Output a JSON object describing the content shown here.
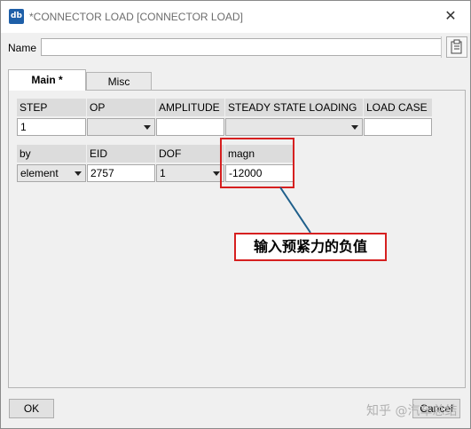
{
  "window": {
    "title": "*CONNECTOR LOAD [CONNECTOR LOAD]",
    "icon_label": "db"
  },
  "name_row": {
    "label": "Name",
    "value": ""
  },
  "tabs": [
    {
      "label": "Main *",
      "active": true
    },
    {
      "label": "Misc",
      "active": false
    }
  ],
  "row1": {
    "step": {
      "header": "STEP",
      "value": "1"
    },
    "op": {
      "header": "OP",
      "value": ""
    },
    "amplitude": {
      "header": "AMPLITUDE",
      "value": ""
    },
    "steady_state": {
      "header": "STEADY STATE LOADING",
      "value": ""
    },
    "load_case": {
      "header": "LOAD CASE",
      "value": ""
    }
  },
  "row2": {
    "by": {
      "header": "by",
      "value": "element"
    },
    "eid": {
      "header": "EID",
      "value": "2757"
    },
    "dof": {
      "header": "DOF",
      "value": "1"
    },
    "magn": {
      "header": "magn",
      "value": "-12000"
    }
  },
  "annotation": {
    "text": "输入预紧力的负值",
    "color": "#d62020"
  },
  "buttons": {
    "ok": "OK",
    "cancel": "Cancel"
  },
  "watermark": "知乎 @汽车总结"
}
